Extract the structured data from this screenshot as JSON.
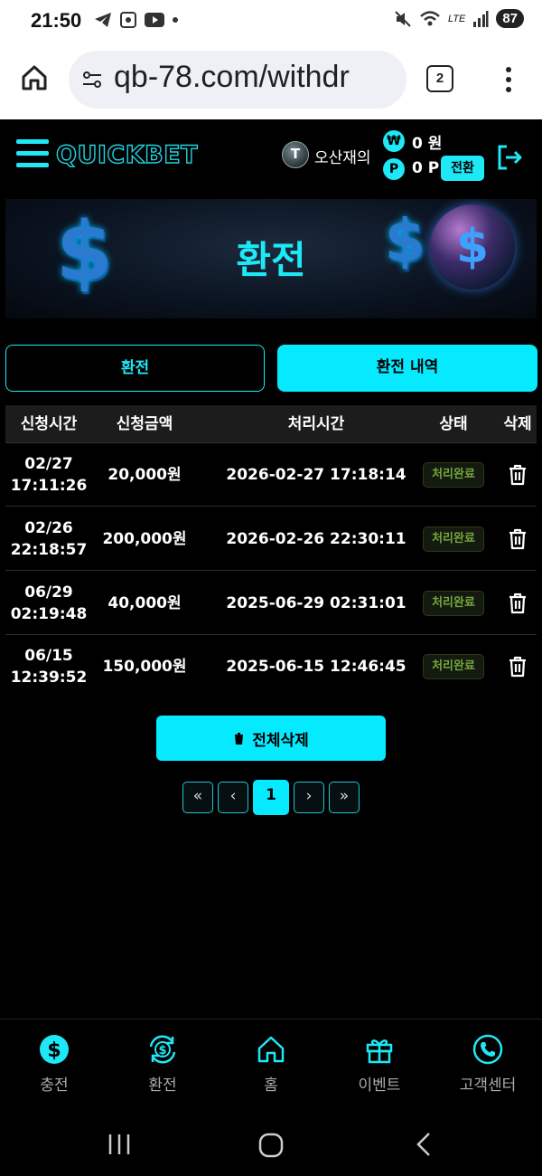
{
  "status_bar": {
    "time": "21:50",
    "battery": "87",
    "network": "LTE"
  },
  "browser": {
    "url": "qb-78.com/withdr",
    "tab_count": "2"
  },
  "header": {
    "logo": "QUICKBET",
    "user_badge": "T",
    "username": "오산재의",
    "won_symbol": "₩",
    "point_symbol": "P",
    "balance": "0 원",
    "points": "0 P",
    "convert_label": "전환"
  },
  "banner": {
    "title": "환전"
  },
  "tabs": [
    {
      "label": "환전",
      "active": false
    },
    {
      "label": "환전 내역",
      "active": true
    }
  ],
  "table": {
    "headers": [
      "신청시간",
      "신청금액",
      "처리시간",
      "상태",
      "삭제"
    ],
    "rows": [
      {
        "req_date": "02/27",
        "req_time": "17:11:26",
        "amount": "20,000원",
        "processed": "2026-02-27 17:18:14",
        "status": "처리완료"
      },
      {
        "req_date": "02/26",
        "req_time": "22:18:57",
        "amount": "200,000원",
        "processed": "2026-02-26 22:30:11",
        "status": "처리완료"
      },
      {
        "req_date": "06/29",
        "req_time": "02:19:48",
        "amount": "40,000원",
        "processed": "2025-06-29 02:31:01",
        "status": "처리완료"
      },
      {
        "req_date": "06/15",
        "req_time": "12:39:52",
        "amount": "150,000원",
        "processed": "2025-06-15 12:46:45",
        "status": "처리완료"
      }
    ]
  },
  "delete_all_label": "전체삭제",
  "pagination": {
    "first": "«",
    "prev": "‹",
    "current": "1",
    "next": "›",
    "last": "»"
  },
  "bottom_nav": [
    {
      "label": "충전",
      "icon": "dollar-coin-icon"
    },
    {
      "label": "환전",
      "icon": "exchange-icon"
    },
    {
      "label": "홈",
      "icon": "home-icon"
    },
    {
      "label": "이벤트",
      "icon": "gift-icon"
    },
    {
      "label": "고객센터",
      "icon": "phone-icon"
    }
  ],
  "colors": {
    "accent": "#06eaff",
    "status_text": "#73a838",
    "background": "#000000"
  }
}
